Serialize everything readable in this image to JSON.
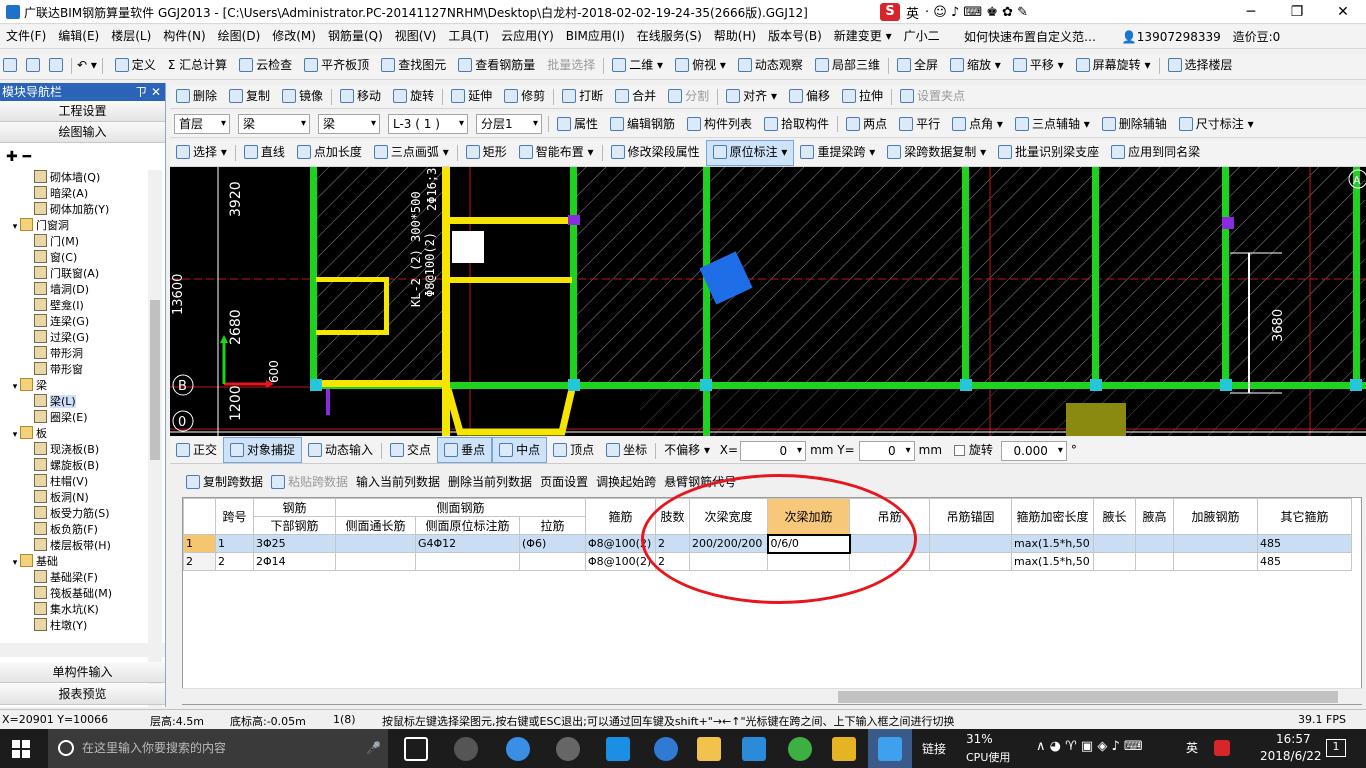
{
  "window": {
    "title": "广联达BIM钢筋算量软件 GGJ2013 - [C:\\Users\\Administrator.PC-20141127NRHM\\Desktop\\白龙村-2018-02-02-19-24-35(2666版).GGJ12]",
    "ime_label": "英",
    "controls": [
      "─",
      "❐",
      "✕"
    ]
  },
  "menubar": {
    "items": [
      "文件(F)",
      "编辑(E)",
      "楼层(L)",
      "构件(N)",
      "绘图(D)",
      "修改(M)",
      "钢筋量(Q)",
      "视图(V)",
      "工具(T)",
      "云应用(Y)",
      "BIM应用(I)",
      "在线服务(S)",
      "帮助(H)",
      "版本号(B)",
      "新建变更 ▾",
      "广小二"
    ],
    "search_hint": "如何快速布置自定义范…",
    "phone": "13907298339",
    "beans": "造价豆:0"
  },
  "toolbar1": {
    "items": [
      "定义",
      "Σ 汇总计算",
      "云检查",
      "平齐板顶",
      "查找图元",
      "查看钢筋量",
      "批量选择",
      "二维 ▾",
      "俯视 ▾",
      "动态观察",
      "局部三维",
      "全屏",
      "缩放 ▾",
      "平移 ▾",
      "屏幕旋转 ▾",
      "选择楼层"
    ]
  },
  "toolbar2": {
    "items": [
      "删除",
      "复制",
      "镜像",
      "移动",
      "旋转",
      "延伸",
      "修剪",
      "打断",
      "合并",
      "分割",
      "对齐 ▾",
      "偏移",
      "拉伸",
      "设置夹点"
    ]
  },
  "toolbar3": {
    "combos": [
      "首层",
      "梁",
      "梁",
      "L-3 ( 1 )",
      "分层1"
    ],
    "items": [
      "属性",
      "编辑钢筋",
      "构件列表",
      "拾取构件",
      "两点",
      "平行",
      "点角 ▾",
      "三点辅轴 ▾",
      "删除辅轴",
      "尺寸标注 ▾"
    ]
  },
  "toolbar4": {
    "items": [
      "选择 ▾",
      "直线",
      "点加长度",
      "三点画弧 ▾",
      "矩形",
      "智能布置 ▾",
      "修改梁段属性",
      "原位标注 ▾",
      "重提梁跨 ▾",
      "梁跨数据复制 ▾",
      "批量识别梁支座",
      "应用到同名梁"
    ]
  },
  "nav": {
    "title": "模块导航栏",
    "pin": "ㄗ ✕",
    "buttons": [
      "工程设置",
      "绘图输入"
    ],
    "bottom_buttons": [
      "单构件输入",
      "报表预览"
    ],
    "tree": [
      {
        "label": "砌体墙(Q)",
        "level": 2
      },
      {
        "label": "暗梁(A)",
        "level": 2
      },
      {
        "label": "砌体加筋(Y)",
        "level": 2
      },
      {
        "label": "门窗洞",
        "level": 1,
        "group": true
      },
      {
        "label": "门(M)",
        "level": 2
      },
      {
        "label": "窗(C)",
        "level": 2
      },
      {
        "label": "门联窗(A)",
        "level": 2
      },
      {
        "label": "墙洞(D)",
        "level": 2
      },
      {
        "label": "壁龛(I)",
        "level": 2
      },
      {
        "label": "连梁(G)",
        "level": 2
      },
      {
        "label": "过梁(G)",
        "level": 2
      },
      {
        "label": "带形洞",
        "level": 2
      },
      {
        "label": "带形窗",
        "level": 2
      },
      {
        "label": "梁",
        "level": 1,
        "group": true
      },
      {
        "label": "梁(L)",
        "level": 2,
        "selected": true
      },
      {
        "label": "圈梁(E)",
        "level": 2
      },
      {
        "label": "板",
        "level": 1,
        "group": true
      },
      {
        "label": "现浇板(B)",
        "level": 2
      },
      {
        "label": "螺旋板(B)",
        "level": 2
      },
      {
        "label": "柱帽(V)",
        "level": 2
      },
      {
        "label": "板洞(N)",
        "level": 2
      },
      {
        "label": "板受力筋(S)",
        "level": 2
      },
      {
        "label": "板负筋(F)",
        "level": 2
      },
      {
        "label": "楼层板带(H)",
        "level": 2
      },
      {
        "label": "基础",
        "level": 1,
        "group": true
      },
      {
        "label": "基础梁(F)",
        "level": 2
      },
      {
        "label": "筏板基础(M)",
        "level": 2
      },
      {
        "label": "集水坑(K)",
        "level": 2
      },
      {
        "label": "柱墩(Y)",
        "level": 2
      }
    ]
  },
  "canvas": {
    "dims": [
      "3920",
      "13600",
      "2680",
      "1200",
      "3680",
      "600"
    ],
    "axis_labels": [
      "B",
      "0",
      "A"
    ],
    "beam_text": [
      "KL-2 (2) 300*500",
      "Φ8@100(2)",
      "2Φ16;3"
    ]
  },
  "snapbar": {
    "items": [
      "正交",
      "对象捕捉",
      "动态输入",
      "交点",
      "垂点",
      "中点",
      "顶点",
      "坐标",
      "不偏移 ▾"
    ],
    "x_label": "X=",
    "x_value": "0",
    "y_label": "mm Y=",
    "y_value": "0",
    "unit": "mm",
    "rotate_label": "旋转",
    "rotate_value": "0.000",
    "deg": "°"
  },
  "gridbar": {
    "items": [
      "复制跨数据",
      "粘贴跨数据",
      "输入当前列数据",
      "删除当前列数据",
      "页面设置",
      "调换起始跨",
      "悬臂钢筋代号"
    ]
  },
  "grid": {
    "header_top": [
      "跨号",
      "钢筋",
      "侧面钢筋",
      "箍筋",
      "肢数",
      "次梁宽度",
      "次梁加筋",
      "吊筋",
      "吊筋锚固",
      "箍筋加密长度",
      "腋长",
      "腋高",
      "加腋钢筋",
      "其它箍筋"
    ],
    "header_sub": [
      "下部钢筋",
      "侧面通长筋",
      "侧面原位标注筋",
      "拉筋"
    ],
    "rows": [
      {
        "n": "1",
        "span": "1",
        "bottom": "3Φ25",
        "side_long": "",
        "side_orig": "G4Φ12",
        "tie": "(Φ6)",
        "stirrup": "Φ8@100(2)",
        "legs": "2",
        "sec_width": "200/200/200",
        "sec_add": "0/6/0",
        "hanger": "",
        "hanger_anchor": "",
        "dense": "max(1.5*h,50",
        "ye_len": "",
        "ye_h": "",
        "ye_bar": "",
        "other": "485"
      },
      {
        "n": "2",
        "span": "2",
        "bottom": "2Φ14",
        "side_long": "",
        "side_orig": "",
        "tie": "",
        "stirrup": "Φ8@100(2)",
        "legs": "2",
        "sec_width": "",
        "sec_add": "",
        "hanger": "",
        "hanger_anchor": "",
        "dense": "max(1.5*h,50",
        "ye_len": "",
        "ye_h": "",
        "ye_bar": "",
        "other": "485"
      }
    ]
  },
  "status": {
    "coord": "X=20901 Y=10066",
    "floor_h": "层高:4.5m",
    "base_h": "底标高:-0.05m",
    "count": "1(8)",
    "hint": "按鼠标左键选择梁图元,按右键或ESC退出;可以通过回车键及shift+\"→←↑\"光标键在跨之间、上下输入框之间进行切换",
    "fps": "39.1 FPS"
  },
  "taskbar": {
    "search": "在这里输入你要搜索的内容",
    "network": "链接",
    "cpu_pct": "31%",
    "cpu_label": "CPU使用",
    "lang": "英",
    "time": "16:57",
    "date": "2018/6/22",
    "notif": "1"
  },
  "colors": {
    "nav_head": "#2a63b8",
    "beam_yellow": "#f5e500",
    "wall_green": "#1fd21f",
    "mark_red": "#e8161c"
  }
}
